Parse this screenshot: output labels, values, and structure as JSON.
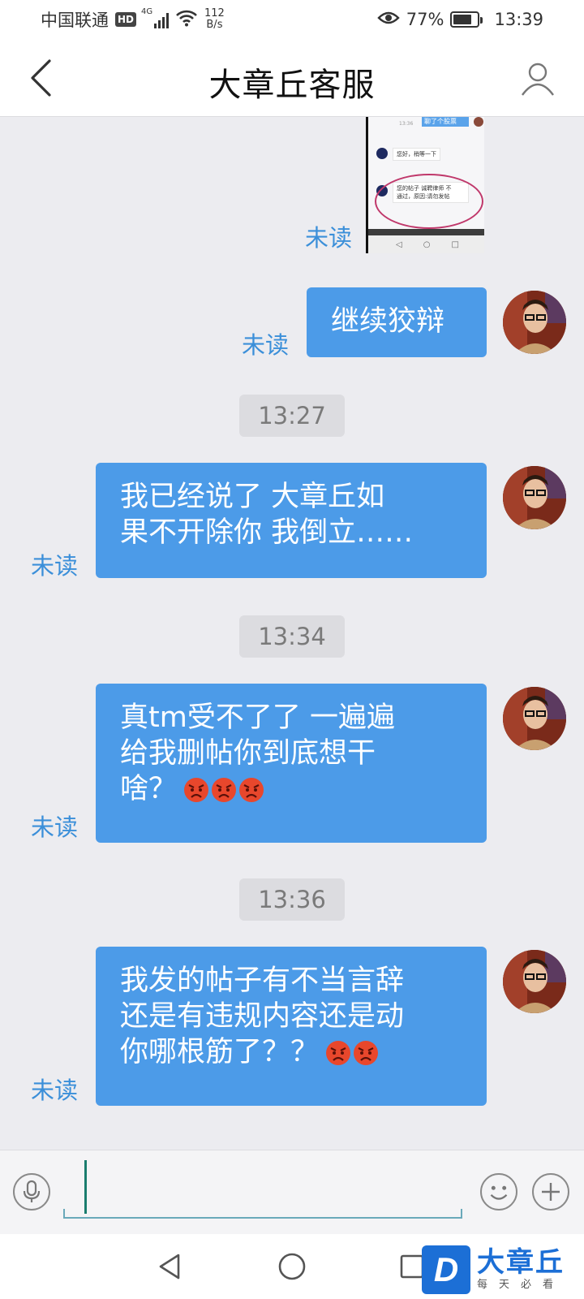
{
  "status_bar": {
    "carrier": "中国联通",
    "hd": "HD",
    "network": "4G",
    "speed_value": "112",
    "speed_unit": "B/s",
    "battery": "77%",
    "battery_level": 0.77,
    "time": "13:39"
  },
  "header": {
    "title": "大章丘客服"
  },
  "messages": [
    {
      "type": "image",
      "status": "未读"
    },
    {
      "type": "text",
      "text": "继续狡辩",
      "status": "未读"
    },
    {
      "type": "time",
      "text": "13:27"
    },
    {
      "type": "text",
      "lines": [
        "我已经说了 大章丘如",
        "果不开除你 我倒立……"
      ],
      "status": "未读"
    },
    {
      "type": "time",
      "text": "13:34"
    },
    {
      "type": "text",
      "lines": [
        "真tm受不了了 一遍遍",
        "给我删帖你到底想干",
        "啥？"
      ],
      "emoji_count": 3,
      "status": "未读"
    },
    {
      "type": "time",
      "text": "13:36"
    },
    {
      "type": "text",
      "lines": [
        "我发的帖子有不当言辞",
        "还是有违规内容还是动",
        "你哪根筋了？？"
      ],
      "emoji_count": 2,
      "status": "未读"
    }
  ],
  "thumbnail": {
    "blue_bubble": "聊了个股票",
    "greeting": "您好，稍等一下",
    "notice_line1": "您的帖子 诚聘律师 不",
    "notice_line2": "通过，原因:请勿发帖"
  },
  "input": {
    "placeholder": "",
    "value": ""
  },
  "watermark": {
    "mark": "D",
    "name": "大章丘",
    "slogan": "每天必看"
  },
  "colors": {
    "bubble": "#4c9be8",
    "unread": "#3b8fd9",
    "background": "#ececf0"
  }
}
